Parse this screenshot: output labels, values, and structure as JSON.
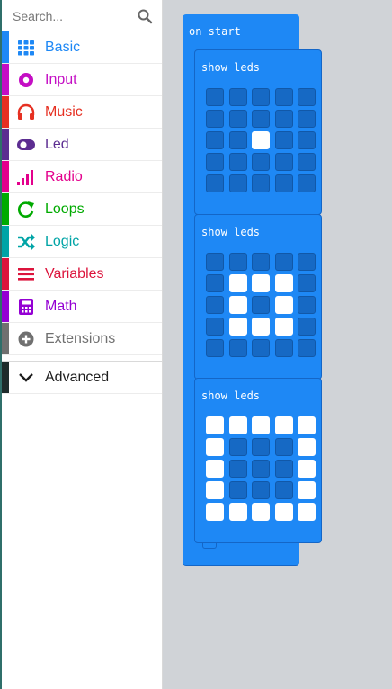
{
  "search": {
    "placeholder": "Search..."
  },
  "categories": [
    {
      "key": "basic",
      "label": "Basic",
      "icon": "grid-icon",
      "color": "#1e88f5"
    },
    {
      "key": "input",
      "label": "Input",
      "icon": "radio-button-icon",
      "color": "#c40ec4"
    },
    {
      "key": "music",
      "label": "Music",
      "icon": "headphones-icon",
      "color": "#e63022"
    },
    {
      "key": "led",
      "label": "Led",
      "icon": "toggle-icon",
      "color": "#5c2d91"
    },
    {
      "key": "radio",
      "label": "Radio",
      "icon": "signal-bars-icon",
      "color": "#e3008c"
    },
    {
      "key": "loops",
      "label": "Loops",
      "icon": "refresh-icon",
      "color": "#00aa00"
    },
    {
      "key": "logic",
      "label": "Logic",
      "icon": "shuffle-icon",
      "color": "#00a4a6"
    },
    {
      "key": "variables",
      "label": "Variables",
      "icon": "list-icon",
      "color": "#dc143c"
    },
    {
      "key": "math",
      "label": "Math",
      "icon": "calculator-icon",
      "color": "#9400d3"
    },
    {
      "key": "extensions",
      "label": "Extensions",
      "icon": "plus-circle-icon",
      "color": "#707070"
    }
  ],
  "advanced": {
    "label": "Advanced",
    "icon": "chevron-down-icon"
  },
  "workspace": {
    "event_block": {
      "label": "on start",
      "color": "#1e88f5"
    },
    "show_leds_blocks": [
      {
        "label": "show leds",
        "grid": [
          [
            0,
            0,
            0,
            0,
            0
          ],
          [
            0,
            0,
            0,
            0,
            0
          ],
          [
            0,
            0,
            1,
            0,
            0
          ],
          [
            0,
            0,
            0,
            0,
            0
          ],
          [
            0,
            0,
            0,
            0,
            0
          ]
        ]
      },
      {
        "label": "show leds",
        "grid": [
          [
            0,
            0,
            0,
            0,
            0
          ],
          [
            0,
            1,
            1,
            1,
            0
          ],
          [
            0,
            1,
            0,
            1,
            0
          ],
          [
            0,
            1,
            1,
            1,
            0
          ],
          [
            0,
            0,
            0,
            0,
            0
          ]
        ]
      },
      {
        "label": "show leds",
        "grid": [
          [
            1,
            1,
            1,
            1,
            1
          ],
          [
            1,
            0,
            0,
            0,
            1
          ],
          [
            1,
            0,
            0,
            0,
            1
          ],
          [
            1,
            0,
            0,
            0,
            1
          ],
          [
            1,
            1,
            1,
            1,
            1
          ]
        ]
      }
    ]
  }
}
